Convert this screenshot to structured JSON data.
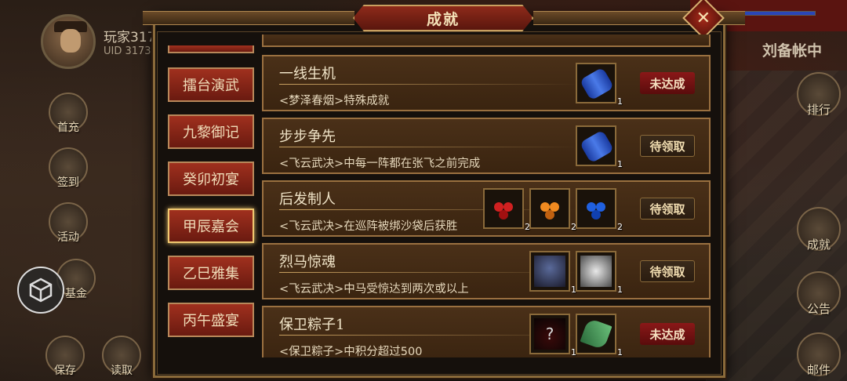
{
  "player": {
    "name": "玩家317",
    "uid": "UID  3173"
  },
  "window": {
    "title": "成就",
    "close_label": "✕"
  },
  "left_buttons": [
    "首充",
    "签到",
    "活动",
    "基金",
    "保存",
    "读取"
  ],
  "right_panel": {
    "title": "刘备帐中",
    "buttons": [
      "排行",
      "成就",
      "公告",
      "邮件"
    ]
  },
  "tabs": [
    "擂台演武",
    "九黎御记",
    "癸卯初宴",
    "甲辰嘉会",
    "乙巳雅集",
    "丙午盛宴"
  ],
  "active_tab": "甲辰嘉会",
  "achievements": [
    {
      "name": "一线生机",
      "desc": "<梦泽春烟>特殊成就",
      "status": "未达成",
      "status_type": "no",
      "rewards": [
        {
          "icon": "scroll-icon",
          "count": "1"
        }
      ]
    },
    {
      "name": "步步争先",
      "desc": "<飞云武决>中每一阵都在张飞之前完成",
      "status": "待领取",
      "status_type": "claim",
      "rewards": [
        {
          "icon": "scroll-icon",
          "count": "1"
        }
      ]
    },
    {
      "name": "后发制人",
      "desc": "<飞云武决>在巡阵被绑沙袋后获胜",
      "status": "待领取",
      "status_type": "claim",
      "rewards": [
        {
          "icon": "red-berry-icon",
          "count": "2"
        },
        {
          "icon": "orange-berry-icon",
          "count": "2"
        },
        {
          "icon": "blue-berry-icon",
          "count": "2"
        }
      ]
    },
    {
      "name": "烈马惊魂",
      "desc": "<飞云武决>中马受惊达到两次或以上",
      "status": "待领取",
      "status_type": "claim",
      "rewards": [
        {
          "icon": "rider-icon",
          "count": "1"
        },
        {
          "icon": "white-horse-icon",
          "count": "1"
        }
      ]
    },
    {
      "name": "保卫粽子1",
      "desc": "<保卫粽子>中积分超过500",
      "status": "未达成",
      "status_type": "no",
      "rewards": [
        {
          "icon": "mystery-box-icon",
          "count": "1"
        },
        {
          "icon": "zongzi-leaf-icon",
          "count": "1"
        }
      ]
    }
  ],
  "colors": {
    "accent_gold": "#c8a060",
    "tab_red": "#a0301e",
    "status_red": "#8a1818"
  }
}
